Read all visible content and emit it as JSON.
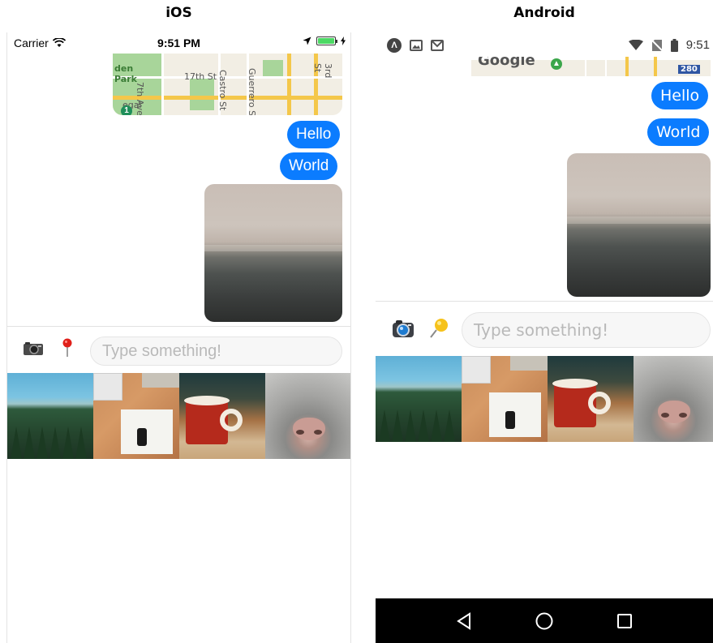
{
  "titles": {
    "ios": "iOS",
    "android": "Android"
  },
  "ios": {
    "status": {
      "carrier": "Carrier",
      "time": "9:51 PM"
    },
    "map": {
      "labels": [
        "den",
        "Park",
        "7th Ave",
        "17th St",
        "Castro St",
        "Guerrero St",
        "3rd St",
        "egal"
      ],
      "route_sign": "1"
    },
    "messages": [
      "Hello",
      "World"
    ],
    "input_placeholder": "Type something!",
    "photos": [
      "forest-lake",
      "desk",
      "mug",
      "cat-nose"
    ]
  },
  "android": {
    "status": {
      "time": "9:51"
    },
    "map": {
      "brand": "Google",
      "route_sign": "280"
    },
    "messages": [
      "Hello",
      "World"
    ],
    "input_placeholder": "Type something!",
    "photos": [
      "forest-lake",
      "desk",
      "mug",
      "cat-nose"
    ]
  },
  "icons": {
    "ios_camera": "camera-icon",
    "ios_location": "pin-icon",
    "android_camera": "camera-icon",
    "android_location": "pin-icon",
    "android_back": "back-icon",
    "android_home": "home-icon",
    "android_recents": "recents-icon"
  },
  "colors": {
    "bubble": "#0b7cff",
    "bubble_text": "#ffffff",
    "placeholder": "#b9b9b9",
    "navbar": "#000000"
  }
}
